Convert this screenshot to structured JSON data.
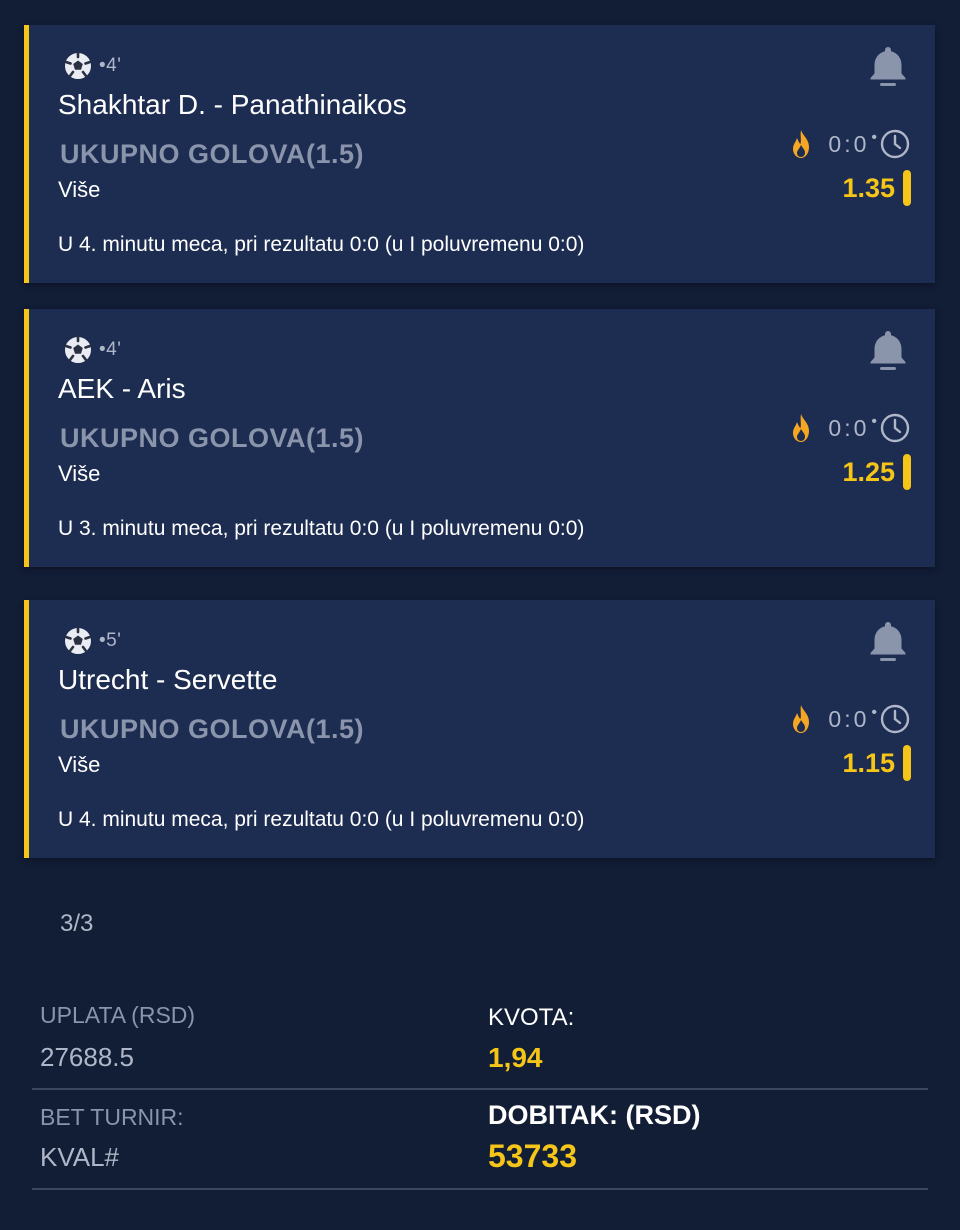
{
  "matches": [
    {
      "minute": "•4'",
      "teams": "Shakhtar D. - Panathinaikos",
      "market": "UKUPNO GOLOVA(1.5)",
      "pick": "Više",
      "score_home": "0",
      "score_away": "0",
      "odds": "1.35",
      "description": "U 4. minutu meca, pri rezultatu 0:0 (u I poluvremenu 0:0)"
    },
    {
      "minute": "•4'",
      "teams": "AEK - Aris",
      "market": "UKUPNO GOLOVA(1.5)",
      "pick": "Više",
      "score_home": "0",
      "score_away": "0",
      "odds": "1.25",
      "description": "U 3. minutu meca, pri rezultatu 0:0 (u I poluvremenu 0:0)"
    },
    {
      "minute": "•5'",
      "teams": "Utrecht - Servette",
      "market": "UKUPNO GOLOVA(1.5)",
      "pick": "Više",
      "score_home": "0",
      "score_away": "0",
      "odds": "1.15",
      "description": "U 4. minutu meca, pri rezultatu 0:0 (u I poluvremenu 0:0)"
    }
  ],
  "pager": "3/3",
  "summary": {
    "stake_label": "UPLATA (RSD)",
    "stake_value": "27688.5",
    "odds_label": "KVOTA:",
    "odds_value": "1,94",
    "tournament_label": "BET TURNIR:",
    "tournament_value": "KVAL#",
    "payout_label": "DOBITAK: (RSD)",
    "payout_value": "53733"
  },
  "colors": {
    "background": "#121d36",
    "card": "#1d2c51",
    "accent": "#f5c518",
    "muted": "#8a94ab"
  },
  "icons": [
    "football-icon",
    "bell-icon",
    "flame-icon",
    "clock-icon"
  ]
}
